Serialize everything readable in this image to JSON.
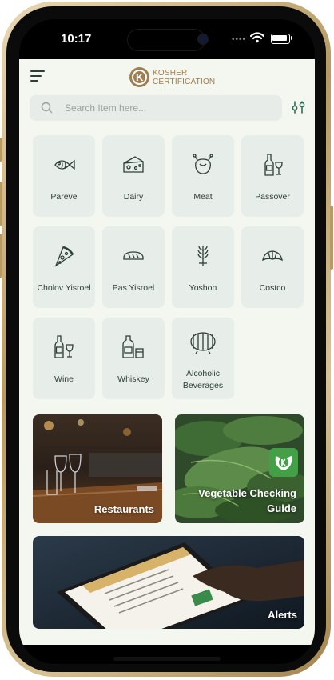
{
  "status": {
    "time": "10:17",
    "signal_dots": "••••"
  },
  "header": {
    "logo_letter": "K",
    "logo_line1": "KOSHER",
    "logo_line2": "CERTIFICATION"
  },
  "search": {
    "placeholder": "Search Item here..."
  },
  "categories": [
    {
      "label": "Pareve",
      "icon": "fish-icon"
    },
    {
      "label": "Dairy",
      "icon": "cheese-icon"
    },
    {
      "label": "Meat",
      "icon": "poultry-icon"
    },
    {
      "label": "Passover",
      "icon": "wine-bottle-glass-icon"
    },
    {
      "label": "Cholov Yisroel",
      "icon": "pizza-icon"
    },
    {
      "label": "Pas Yisroel",
      "icon": "bread-icon"
    },
    {
      "label": "Yoshon",
      "icon": "wheat-icon"
    },
    {
      "label": "Costco",
      "icon": "croissant-icon"
    },
    {
      "label": "Wine",
      "icon": "wine-icon"
    },
    {
      "label": "Whiskey",
      "icon": "whiskey-icon"
    },
    {
      "label": "Alcoholic Beverages",
      "icon": "barrel-icon"
    }
  ],
  "cards": {
    "restaurants": "Restaurants",
    "vegetable": "Vegetable Checking Guide",
    "alerts": "Alerts"
  },
  "colors": {
    "accent": "#2f6f5a",
    "background": "#f3f7f0",
    "tile": "#e7ede8",
    "brand": "#a07e4f",
    "badge_green": "#43a047"
  }
}
